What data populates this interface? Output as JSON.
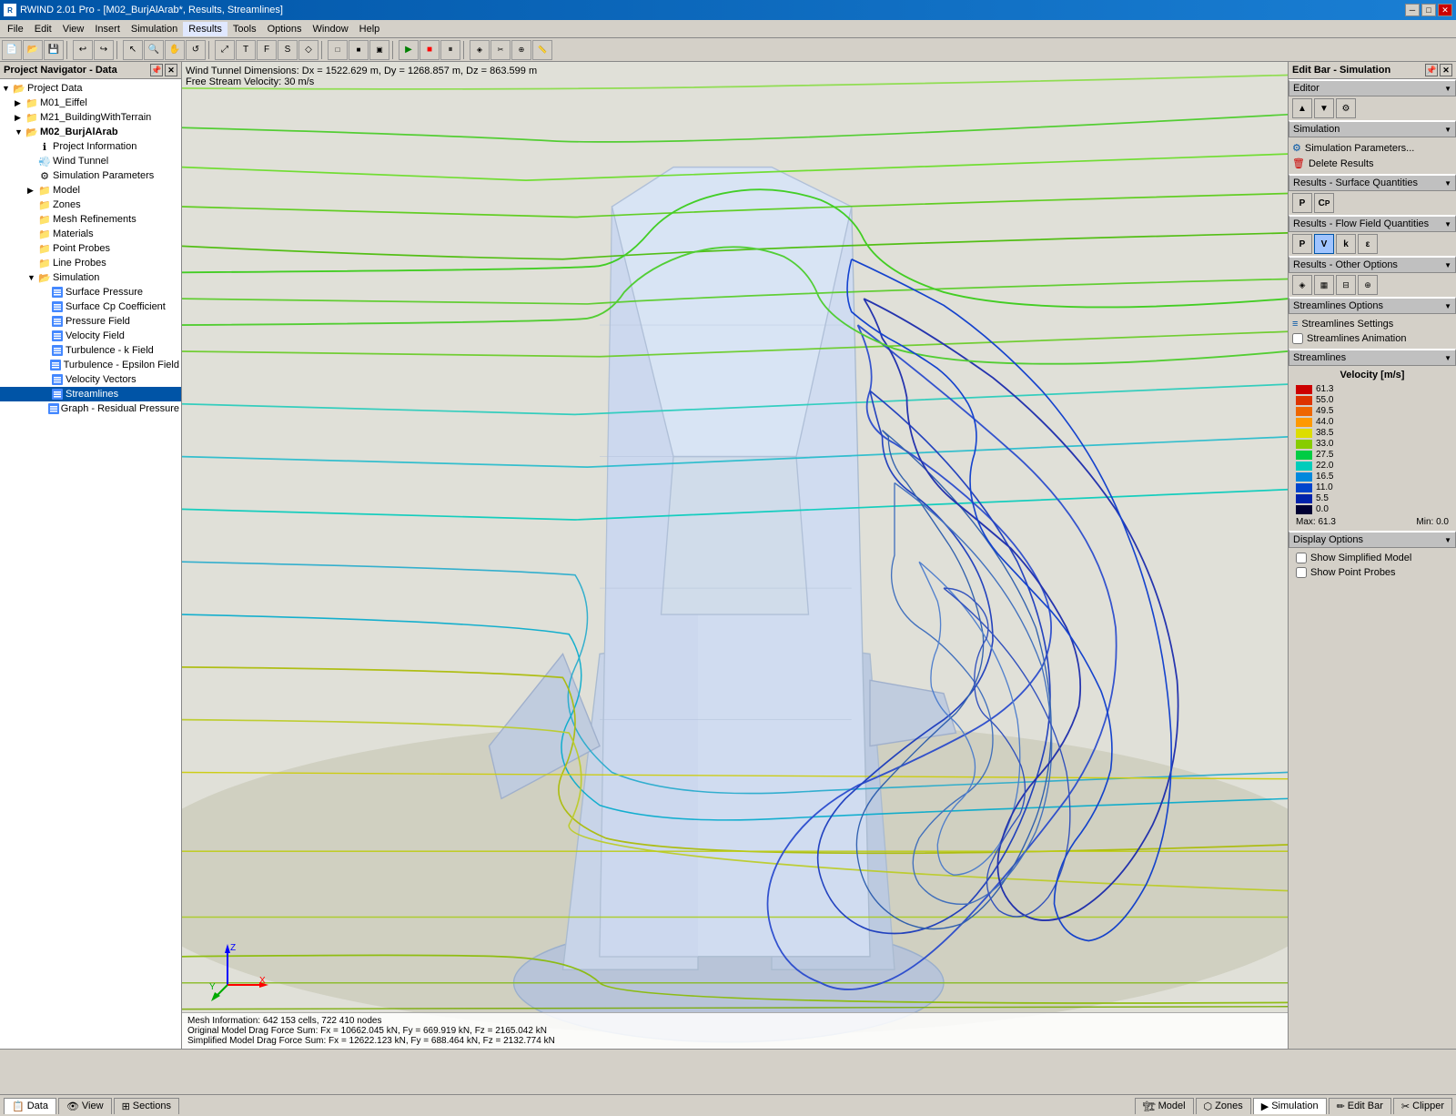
{
  "titlebar": {
    "title": "RWIND 2.01 Pro - [M02_BurjAlArab*, Results, Streamlines]",
    "icon": "rwind-icon"
  },
  "menubar": {
    "items": [
      "File",
      "Edit",
      "View",
      "Insert",
      "Simulation",
      "Results",
      "Tools",
      "Options",
      "Window",
      "Help"
    ]
  },
  "leftpanel": {
    "title": "Project Navigator - Data",
    "tree": [
      {
        "label": "Project Data",
        "level": 0,
        "type": "folder",
        "expanded": true
      },
      {
        "label": "M01_Eiffel",
        "level": 1,
        "type": "folder",
        "expanded": false
      },
      {
        "label": "M21_BuildingWithTerrain",
        "level": 1,
        "type": "folder",
        "expanded": false
      },
      {
        "label": "M02_BurjAlArab",
        "level": 1,
        "type": "folder",
        "expanded": true,
        "bold": true
      },
      {
        "label": "Project Information",
        "level": 2,
        "type": "info"
      },
      {
        "label": "Wind Tunnel",
        "level": 2,
        "type": "tunnel"
      },
      {
        "label": "Simulation Parameters",
        "level": 2,
        "type": "params"
      },
      {
        "label": "Model",
        "level": 2,
        "type": "folder",
        "expanded": false
      },
      {
        "label": "Zones",
        "level": 2,
        "type": "folder"
      },
      {
        "label": "Mesh Refinements",
        "level": 2,
        "type": "folder"
      },
      {
        "label": "Materials",
        "level": 2,
        "type": "folder"
      },
      {
        "label": "Point Probes",
        "level": 2,
        "type": "folder"
      },
      {
        "label": "Line Probes",
        "level": 2,
        "type": "folder"
      },
      {
        "label": "Simulation",
        "level": 2,
        "type": "folder",
        "expanded": true
      },
      {
        "label": "Surface Pressure",
        "level": 3,
        "type": "result"
      },
      {
        "label": "Surface Cp Coefficient",
        "level": 3,
        "type": "result"
      },
      {
        "label": "Pressure Field",
        "level": 3,
        "type": "result"
      },
      {
        "label": "Velocity Field",
        "level": 3,
        "type": "result"
      },
      {
        "label": "Turbulence - k Field",
        "level": 3,
        "type": "result"
      },
      {
        "label": "Turbulence - Epsilon Field",
        "level": 3,
        "type": "result"
      },
      {
        "label": "Velocity Vectors",
        "level": 3,
        "type": "result"
      },
      {
        "label": "Streamlines",
        "level": 3,
        "type": "result",
        "selected": true
      },
      {
        "label": "Graph - Residual Pressure",
        "level": 3,
        "type": "result"
      }
    ]
  },
  "viewport": {
    "info_line1": "Wind Tunnel Dimensions: Dx = 1522.629 m, Dy = 1268.857 m, Dz = 863.599 m",
    "info_line2": "Free Stream Velocity: 30 m/s",
    "status_line1": "Mesh Information: 642 153 cells, 722 410 nodes",
    "status_line2": "Original Model Drag Force Sum: Fx = 10662.045 kN, Fy = 669.919 kN, Fz = 2165.042 kN",
    "status_line3": "Simplified Model Drag Force Sum: Fx = 12622.123 kN, Fy = 688.464 kN, Fz = 2132.774 kN"
  },
  "rightpanel": {
    "title": "Edit Bar - Simulation",
    "sections": {
      "editor": "Editor",
      "simulation": "Simulation",
      "surface_quantities": "Results - Surface Quantities",
      "flow_field": "Results - Flow Field Quantities",
      "other_options": "Results - Other Options",
      "streamlines_options": "Streamlines Options",
      "streamlines": "Streamlines",
      "display_options": "Display Options"
    },
    "sim_buttons": [
      "sim-params-icon",
      "delete-results-icon"
    ],
    "sim_params_label": "Simulation Parameters...",
    "delete_results_label": "Delete Results",
    "surface_btns": [
      "P-btn",
      "Cp-btn"
    ],
    "flow_btns": [
      "P-btn",
      "V-btn",
      "K-btn",
      "E-btn"
    ],
    "other_btns": [
      "iso-btn",
      "contour-btn",
      "slice-btn",
      "probe-btn"
    ],
    "streamlines_options_items": [
      {
        "label": "Streamlines Settings",
        "icon": "settings-icon"
      },
      {
        "label": "Streamlines Animation",
        "icon": "animation-icon",
        "checkbox": true
      }
    ],
    "legend": {
      "title": "Velocity [m/s]",
      "values": [
        {
          "value": "61.3",
          "color": "#cc0000"
        },
        {
          "value": "55.0",
          "color": "#dd2200"
        },
        {
          "value": "49.5",
          "color": "#ee5500"
        },
        {
          "value": "44.0",
          "color": "#ff8800"
        },
        {
          "value": "38.5",
          "color": "#ddcc00"
        },
        {
          "value": "33.0",
          "color": "#88cc00"
        },
        {
          "value": "27.5",
          "color": "#00cc44"
        },
        {
          "value": "22.0",
          "color": "#00cccc"
        },
        {
          "value": "16.5",
          "color": "#0088cc"
        },
        {
          "value": "11.0",
          "color": "#0044bb"
        },
        {
          "value": "5.5",
          "color": "#0000aa"
        },
        {
          "value": "0.0",
          "color": "#000033"
        }
      ],
      "max_label": "Max:",
      "max_value": "61.3",
      "min_label": "Min:",
      "min_value": "0.0"
    },
    "display_options": {
      "show_simplified": "Show Simplified Model",
      "show_point_probes": "Show Point Probes"
    }
  },
  "bottomtabs": {
    "left_tabs": [
      {
        "label": "Data",
        "icon": "data-icon"
      },
      {
        "label": "View",
        "icon": "view-icon"
      },
      {
        "label": "Sections",
        "icon": "sections-icon"
      }
    ],
    "right_tabs": [
      {
        "label": "Model",
        "icon": "model-icon"
      },
      {
        "label": "Zones",
        "icon": "zones-icon"
      },
      {
        "label": "Simulation",
        "icon": "simulation-icon"
      },
      {
        "label": "Edit Bar",
        "icon": "editbar-icon"
      },
      {
        "label": "Clipper",
        "icon": "clipper-icon"
      }
    ]
  }
}
